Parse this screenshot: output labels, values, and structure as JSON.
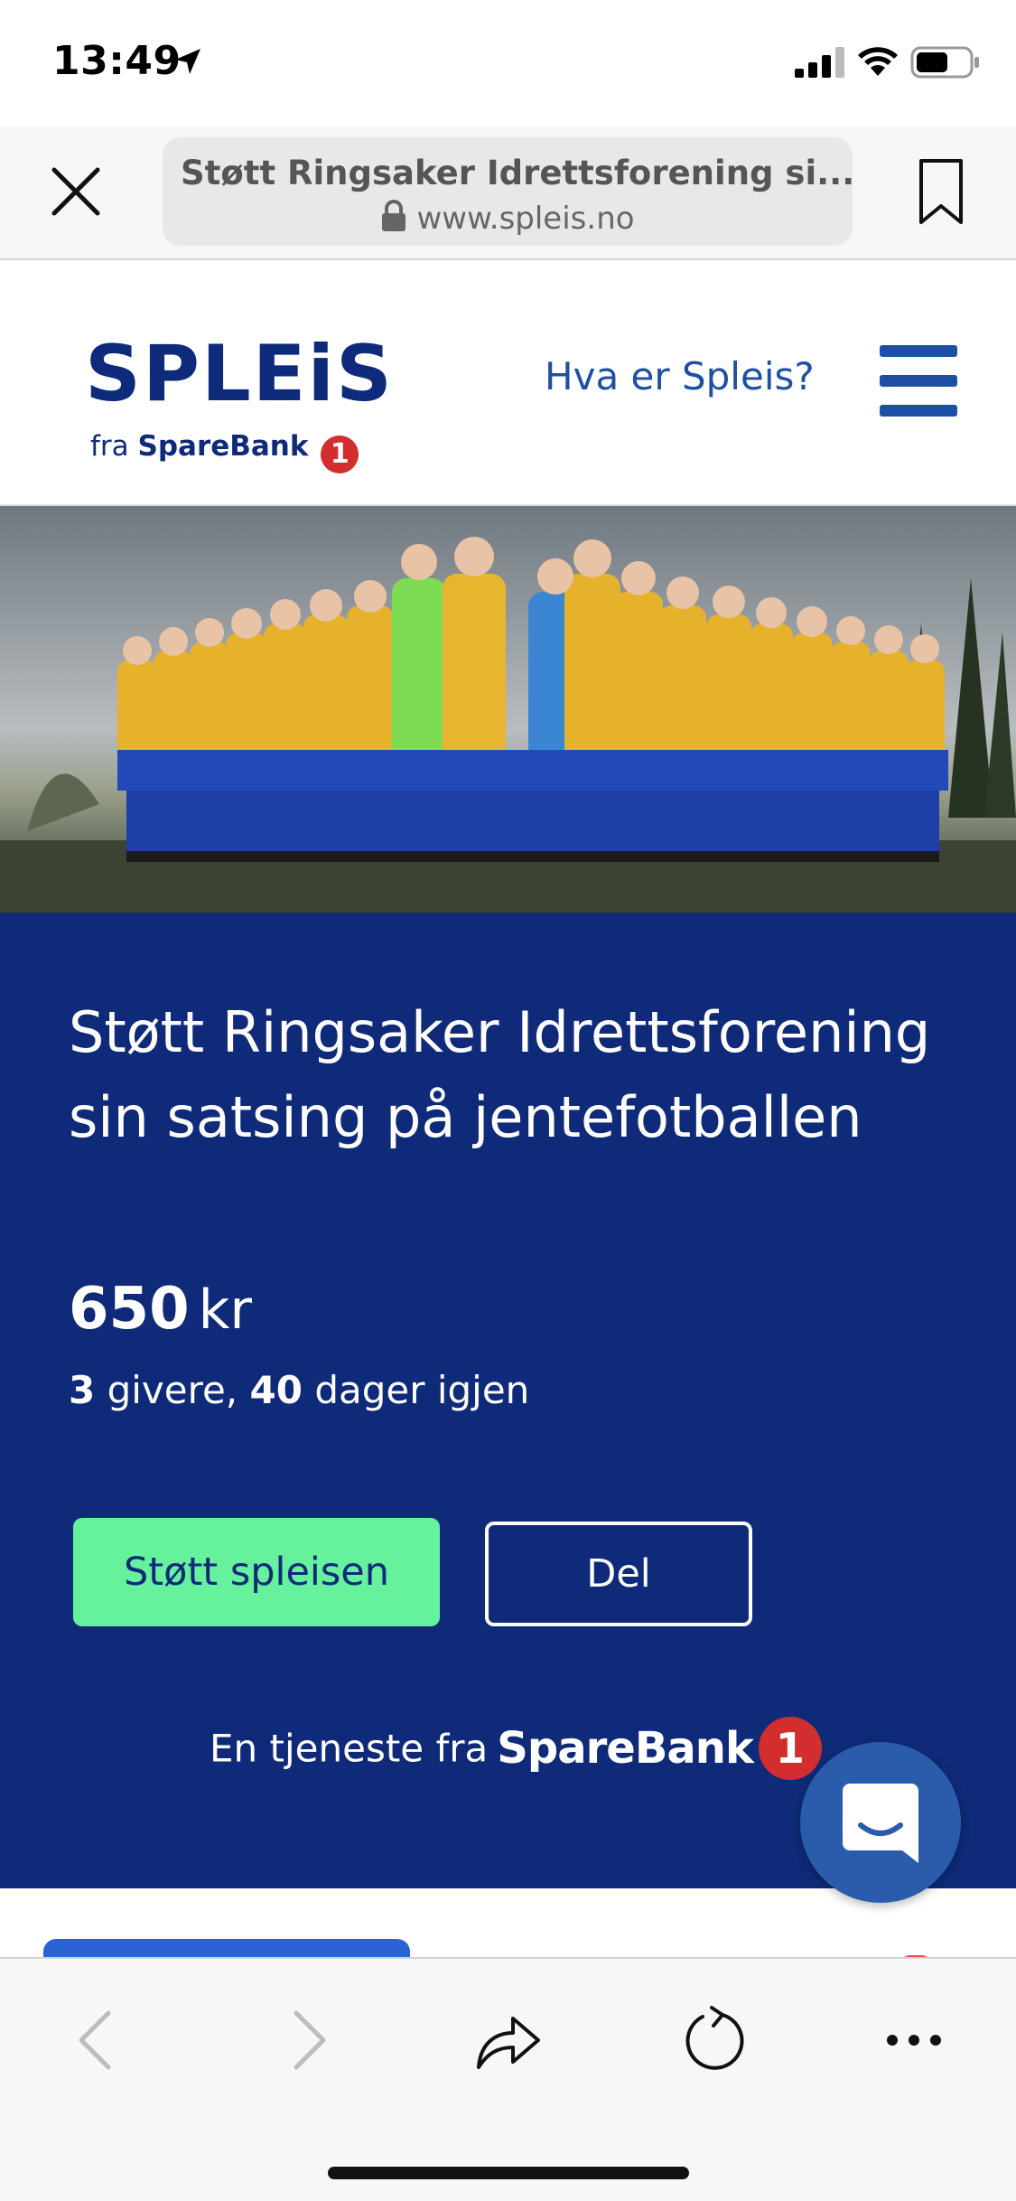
{
  "status_bar": {
    "time": "13:49",
    "icons": [
      "location-arrow-icon",
      "signal-icon",
      "wifi-icon",
      "battery-icon"
    ]
  },
  "browser": {
    "page_title": "Støtt Ringsaker Idrettsforening si...",
    "host": "www.spleis.no",
    "icons": [
      "close-icon",
      "lock-icon",
      "bookmark-icon"
    ]
  },
  "site_header": {
    "logo_text": "SPLEiS",
    "logo_sub_prefix": "fra",
    "logo_sub_brand": "SpareBank",
    "logo_badge": "1",
    "nav_link": "Hva er Spleis?",
    "menu_icon": "hamburger-menu-icon"
  },
  "campaign": {
    "title": "Støtt Ringsaker Idrettsforening sin satsing på jentefotballen",
    "amount_value": "650",
    "amount_unit": "kr",
    "givers_count": "3",
    "givers_label": "givere,",
    "days_count": "40",
    "days_label": "dager igjen",
    "support_button": "Støtt spleisen",
    "share_button": "Del",
    "footer_prefix": "En tjeneste fra",
    "footer_brand": "SpareBank",
    "footer_badge": "1"
  },
  "chat": {
    "icon": "chat-bubble-icon"
  },
  "toolbar": {
    "icons": [
      "back-icon",
      "forward-icon",
      "share-icon",
      "reload-icon",
      "more-icon"
    ]
  },
  "colors": {
    "brand_navy": "#0e2a78",
    "link_blue": "#1e4fa5",
    "cta_green": "#66f29c",
    "sparebank_red": "#d22e2e",
    "chat_blue": "#2b5cab"
  }
}
